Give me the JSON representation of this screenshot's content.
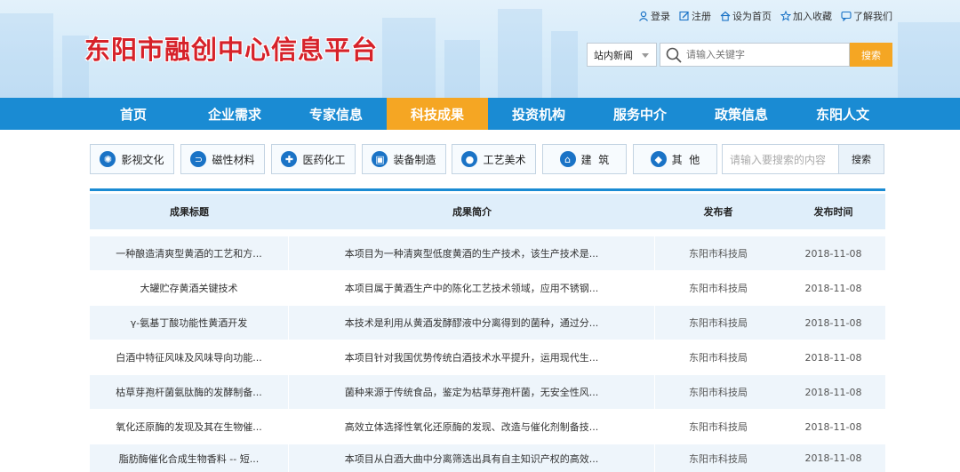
{
  "header": {
    "logo": "东阳市融创中心信息平台",
    "top_links": [
      {
        "label": "登录",
        "icon": "user-icon"
      },
      {
        "label": "注册",
        "icon": "edit-icon"
      },
      {
        "label": "设为首页",
        "icon": "home-icon"
      },
      {
        "label": "加入收藏",
        "icon": "star-icon"
      },
      {
        "label": "了解我们",
        "icon": "chat-icon"
      }
    ],
    "search": {
      "scope": "站内新闻",
      "placeholder": "请输入关键字",
      "button": "搜索"
    }
  },
  "nav": {
    "items": [
      "首页",
      "企业需求",
      "专家信息",
      "科技成果",
      "投资机构",
      "服务中介",
      "政策信息",
      "东阳人文"
    ],
    "active_index": 3
  },
  "categories": [
    {
      "label": "影视文化",
      "icon": "atom-icon"
    },
    {
      "label": "磁性材料",
      "icon": "magnet-icon"
    },
    {
      "label": "医药化工",
      "icon": "medkit-icon"
    },
    {
      "label": "装备制造",
      "icon": "box-icon"
    },
    {
      "label": "工艺美术",
      "icon": "palette-icon"
    },
    {
      "label": "建  筑",
      "icon": "building-icon"
    },
    {
      "label": "其  他",
      "icon": "tag-icon"
    }
  ],
  "category_search": {
    "placeholder": "请输入要搜索的内容",
    "button": "搜索"
  },
  "table": {
    "headers": [
      "成果标题",
      "成果简介",
      "发布者",
      "发布时间"
    ],
    "rows": [
      [
        "一种酿造清爽型黄酒的工艺和方...",
        "本项目为一种清爽型低度黄酒的生产技术，该生产技术是...",
        "东阳市科技局",
        "2018-11-08"
      ],
      [
        "大罐贮存黄酒关键技术",
        "本项目属于黄酒生产中的陈化工艺技术领域，应用不锈钢...",
        "东阳市科技局",
        "2018-11-08"
      ],
      [
        "γ-氨基丁酸功能性黄酒开发",
        "本技术是利用从黄酒发酵醪液中分离得到的菌种，通过分...",
        "东阳市科技局",
        "2018-11-08"
      ],
      [
        "白酒中特征风味及风味导向功能...",
        "本项目针对我国优势传统白酒技术水平提升，运用现代生...",
        "东阳市科技局",
        "2018-11-08"
      ],
      [
        "枯草芽孢杆菌氨肽酶的发酵制备...",
        "菌种来源于传统食品，鉴定为枯草芽孢杆菌，无安全性风...",
        "东阳市科技局",
        "2018-11-08"
      ],
      [
        "氧化还原酶的发现及其在生物催...",
        "高效立体选择性氧化还原酶的发现、改造与催化剂制备技...",
        "东阳市科技局",
        "2018-11-08"
      ],
      [
        "脂肪酶催化合成生物香料 -- 短...",
        "本项目从白酒大曲中分离筛选出具有自主知识产权的高效...",
        "东阳市科技局",
        "2018-11-08"
      ]
    ]
  },
  "colors": {
    "nav_blue": "#1a8bd3",
    "active_orange": "#f5a623",
    "logo_red": "#d6222a",
    "header_bg": "#dfeefa"
  }
}
